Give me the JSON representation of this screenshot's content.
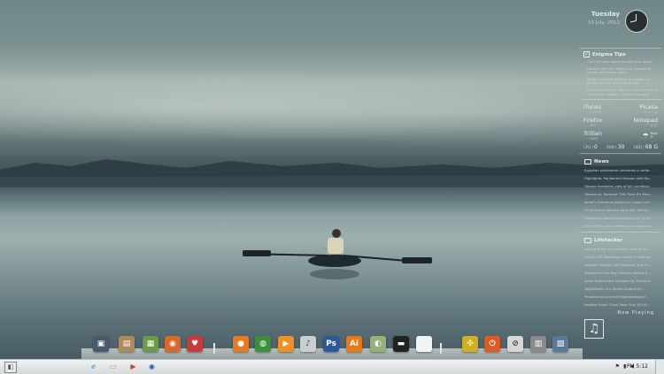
{
  "datetime": {
    "day": "Tuesday",
    "date": "10 July, 2012"
  },
  "tips": {
    "title": "Enigma Tips",
    "items": [
      "Click the icon above to edit your notes!",
      "Double-click the Sidebar or Taskbar to reopen the Home menu.",
      "Middle click the Sidebar or Taskbar to configure your personal scripts.",
      "Middle-click other skins to refresh them (or cycle their content, if they have any)."
    ]
  },
  "apps": [
    {
      "name": "iTunes",
      "sub": "PLAYER"
    },
    {
      "name": "Picasa",
      "sub": "PHOTOS"
    },
    {
      "name": "Firefox",
      "sub": "NET"
    },
    {
      "name": "Notepad",
      "sub": "TEXT"
    },
    {
      "name": "Trillian",
      "sub": "CHAT"
    }
  ],
  "weather": {
    "label": "Rain",
    "value": "5"
  },
  "stats": {
    "cpu_label": "CPU",
    "cpu_value": "0",
    "ram_label": "RAM",
    "ram_value": "30",
    "hdd_label": "HDD",
    "hdd_value": "68 G"
  },
  "news": {
    "title": "News",
    "items": [
      "Egyptian parliament convenes in defia...",
      "Highlights: Parliament Session with Bu...",
      "Obama threatens veto of bill condition...",
      "Obama vs. Romney: This Time It's Pers...",
      "Israel's Olmert acquitted on major corr...",
      "FX to Spend Spanish Bank Aid, the Su...",
      "Congolese Warlord Sentenced to 14 Ye...",
      "PM and HF police drivers set to receive..."
    ]
  },
  "lifehacker": {
    "title": "Lifehacker",
    "items": [
      "How to Break Into Hobbies with an Int...",
      "Intro to 3D Modeling, Lesson 1: Getting...",
      "Google+ Events, iOS Podcasts, and Fa...",
      "Reasons of the Day: Get Jelly Beans A...",
      "Avoid Autocorrect Mistakes by Typing a...",
      "TagAllBooks Is a Search Engine for...",
      "Powered by Android Fragmentation?...",
      "Postbox Email Client Now Only $9.99..."
    ]
  },
  "now_playing": {
    "label": "Now Playing",
    "icon": "music-note-icon"
  },
  "dock": [
    {
      "name": "computer",
      "glyph": "▣",
      "color": "#4a5a6a"
    },
    {
      "name": "documents",
      "glyph": "▤",
      "color": "#b08a5a"
    },
    {
      "name": "pictures",
      "glyph": "▦",
      "color": "#6a9a4a"
    },
    {
      "name": "music",
      "glyph": "◉",
      "color": "#d8692a"
    },
    {
      "name": "favorites",
      "glyph": "♥",
      "color": "#c83a3a"
    },
    {
      "name": "firefox",
      "glyph": "●",
      "color": "#e87a20"
    },
    {
      "name": "chrome",
      "glyph": "◍",
      "color": "#3c8f3c"
    },
    {
      "name": "media-player",
      "glyph": "▶",
      "color": "#f09020"
    },
    {
      "name": "itunes",
      "glyph": "♪",
      "color": "#c9cfd3"
    },
    {
      "name": "photoshop",
      "glyph": "Ps",
      "color": "#2a5a9a"
    },
    {
      "name": "illustrator",
      "glyph": "Ai",
      "color": "#e87a10"
    },
    {
      "name": "globe",
      "glyph": "◐",
      "color": "#9ab07a"
    },
    {
      "name": "terminal",
      "glyph": "▬",
      "color": "#222"
    },
    {
      "name": "blank",
      "glyph": "",
      "color": "#f2f4f4"
    },
    {
      "name": "tools",
      "glyph": "✣",
      "color": "#d0b020"
    },
    {
      "name": "power",
      "glyph": "⏻",
      "color": "#e05a20"
    },
    {
      "name": "no-entry",
      "glyph": "⊘",
      "color": "#d6d6d6"
    },
    {
      "name": "trash",
      "glyph": "▥",
      "color": "#8a8a8a"
    },
    {
      "name": "control-panel",
      "glyph": "▧",
      "color": "#5a7a9a"
    }
  ],
  "taskbar": {
    "time": "PM 5:12"
  }
}
